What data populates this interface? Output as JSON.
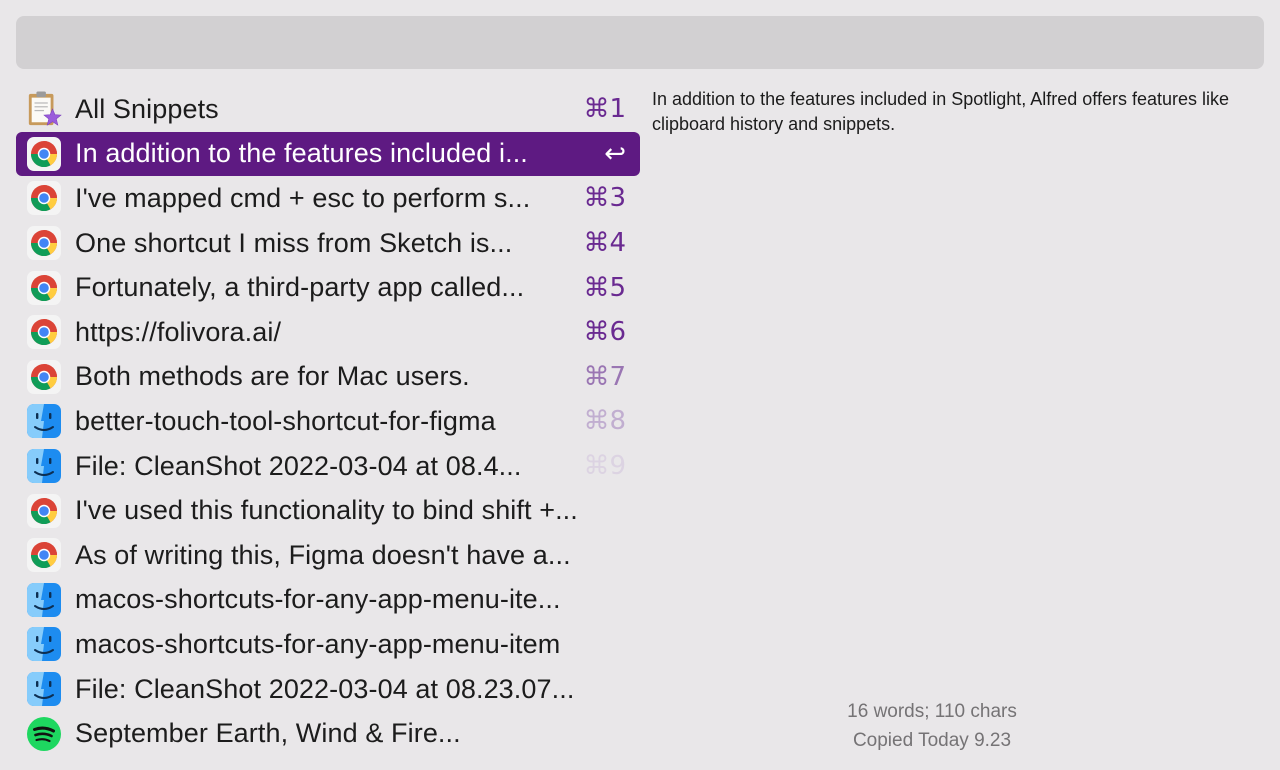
{
  "search": {
    "value": "",
    "placeholder": ""
  },
  "results": [
    {
      "icon": "clipboard-star-icon",
      "label": "All Snippets",
      "shortcut": "⌘1",
      "shortcut_color": "#6a2a91",
      "selected": false
    },
    {
      "icon": "chrome-icon",
      "label": "In addition to the features included i...",
      "shortcut": "↩",
      "shortcut_color": "#ffffff",
      "selected": true
    },
    {
      "icon": "chrome-icon",
      "label": "I've mapped cmd + esc to perform s...",
      "shortcut": "⌘3",
      "shortcut_color": "#6a2a91",
      "selected": false
    },
    {
      "icon": "chrome-icon",
      "label": "One shortcut I miss from Sketch is...",
      "shortcut": "⌘4",
      "shortcut_color": "#6a2a91",
      "selected": false
    },
    {
      "icon": "chrome-icon",
      "label": "Fortunately, a third-party app called...",
      "shortcut": "⌘5",
      "shortcut_color": "#6a2a91",
      "selected": false
    },
    {
      "icon": "chrome-icon",
      "label": "https://folivora.ai/",
      "shortcut": "⌘6",
      "shortcut_color": "#6a2a91",
      "selected": false
    },
    {
      "icon": "chrome-icon",
      "label": "Both methods are for Mac users.",
      "shortcut": "⌘7",
      "shortcut_color": "#9a76b3",
      "selected": false
    },
    {
      "icon": "finder-icon",
      "label": "better-touch-tool-shortcut-for-figma",
      "shortcut": "⌘8",
      "shortcut_color": "#c1aed0",
      "selected": false
    },
    {
      "icon": "finder-icon",
      "label": "File: CleanShot 2022-03-04 at 08.4...",
      "shortcut": "⌘9",
      "shortcut_color": "#dcd3e2",
      "selected": false
    },
    {
      "icon": "chrome-icon",
      "label": "I've used this functionality to bind shift +...",
      "shortcut": "",
      "selected": false
    },
    {
      "icon": "chrome-icon",
      "label": "As of writing this, Figma doesn't have a...",
      "shortcut": "",
      "selected": false
    },
    {
      "icon": "finder-icon",
      "label": "macos-shortcuts-for-any-app-menu-ite...",
      "shortcut": "",
      "selected": false
    },
    {
      "icon": "finder-icon",
      "label": "macos-shortcuts-for-any-app-menu-item",
      "shortcut": "",
      "selected": false
    },
    {
      "icon": "finder-icon",
      "label": "File: CleanShot 2022-03-04 at 08.23.07...",
      "shortcut": "",
      "selected": false
    },
    {
      "icon": "spotify-icon",
      "label": "September Earth, Wind & Fire...",
      "shortcut": "",
      "selected": false
    }
  ],
  "preview": {
    "text": "In addition to the features included in Spotlight, Alfred offers features like clipboard history and snippets."
  },
  "meta": {
    "counts": "16 words; 110 chars",
    "copied": "Copied Today 9.23"
  },
  "colors": {
    "selection": "#5e1a82",
    "accent": "#6a2a91",
    "background": "#e9e7e9"
  }
}
